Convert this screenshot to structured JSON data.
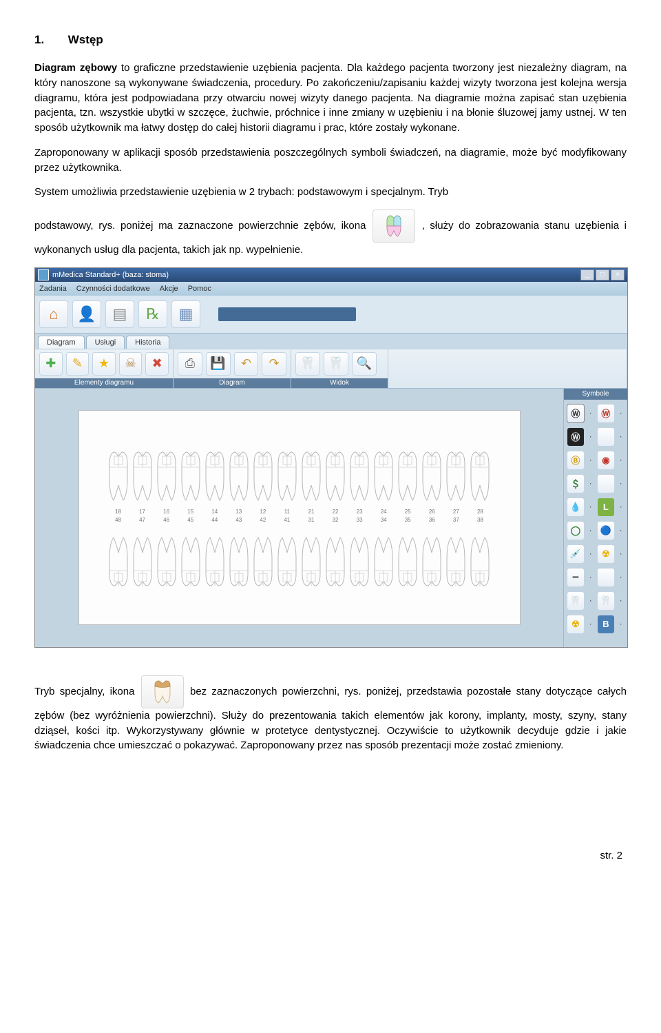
{
  "heading_num": "1.",
  "heading_title": "Wstęp",
  "p1a": "Diagram zębowy",
  "p1b": " to graficzne przedstawienie uzębienia pacjenta. Dla każdego pacjenta tworzony jest niezależny diagram, na który nanoszone są wykonywane świadczenia, procedury. Po zakończeniu/zapisaniu każdej wizyty tworzona jest kolejna wersja diagramu, która jest podpowiadana przy otwarciu nowej wizyty danego pacjenta. Na diagramie można zapisać stan uzębienia pacjenta, tzn. wszystkie ubytki w szczęce, żuchwie, próchnice i inne zmiany w uzębieniu i na błonie śluzowej jamy ustnej. W ten sposób użytkownik ma łatwy dostęp do całej historii diagramu i prac, które zostały wykonane.",
  "p2": "Zaproponowany w aplikacji sposób przedstawienia poszczególnych symboli świadczeń, na diagramie, może być modyfikowany przez użytkownika.",
  "p3": "System umożliwia przedstawienie uzębienia w 2 trybach: podstawowym i specjalnym. Tryb",
  "p4a": "podstawowy, rys. poniżej ma zaznaczone powierzchnie zębów, ikona ",
  "p4b": ", służy do  zobrazowania stanu uzębienia i wykonanych usług dla pacjenta, takich jak np. wypełnienie.",
  "p5a": "Tryb specjalny, ikona ",
  "p5b": " bez zaznaczonych powierzchni, rys. poniżej, przedstawia pozostałe stany dotyczące całych zębów (bez wyróżnienia powierzchni).  Służy do prezentowania takich elementów jak korony, implanty, mosty, szyny, stany dziąseł, kości itp. Wykorzystywany głównie w protetyce dentystycznej. Oczywiście to użytkownik decyduje gdzie i jakie świadczenia chce umieszczać o pokazywać. Zaproponowany przez nas sposób prezentacji może zostać zmieniony.",
  "app": {
    "title": "mMedica Standard+ (baza: stoma)",
    "menu": [
      "Zadania",
      "Czynności dodatkowe",
      "Akcje",
      "Pomoc"
    ],
    "tabs": [
      "Diagram",
      "Usługi",
      "Historia"
    ],
    "groups": [
      "Elementy diagramu",
      "Diagram",
      "Widok"
    ],
    "symbole_header": "Symbole",
    "top_labels": [
      "18",
      "17",
      "16",
      "15",
      "14",
      "13",
      "12",
      "11",
      "21",
      "22",
      "23",
      "24",
      "25",
      "26",
      "27",
      "28"
    ],
    "bot_labels": [
      "48",
      "47",
      "46",
      "45",
      "44",
      "43",
      "42",
      "41",
      "31",
      "32",
      "33",
      "34",
      "35",
      "36",
      "37",
      "38"
    ]
  },
  "footer": "str. 2"
}
